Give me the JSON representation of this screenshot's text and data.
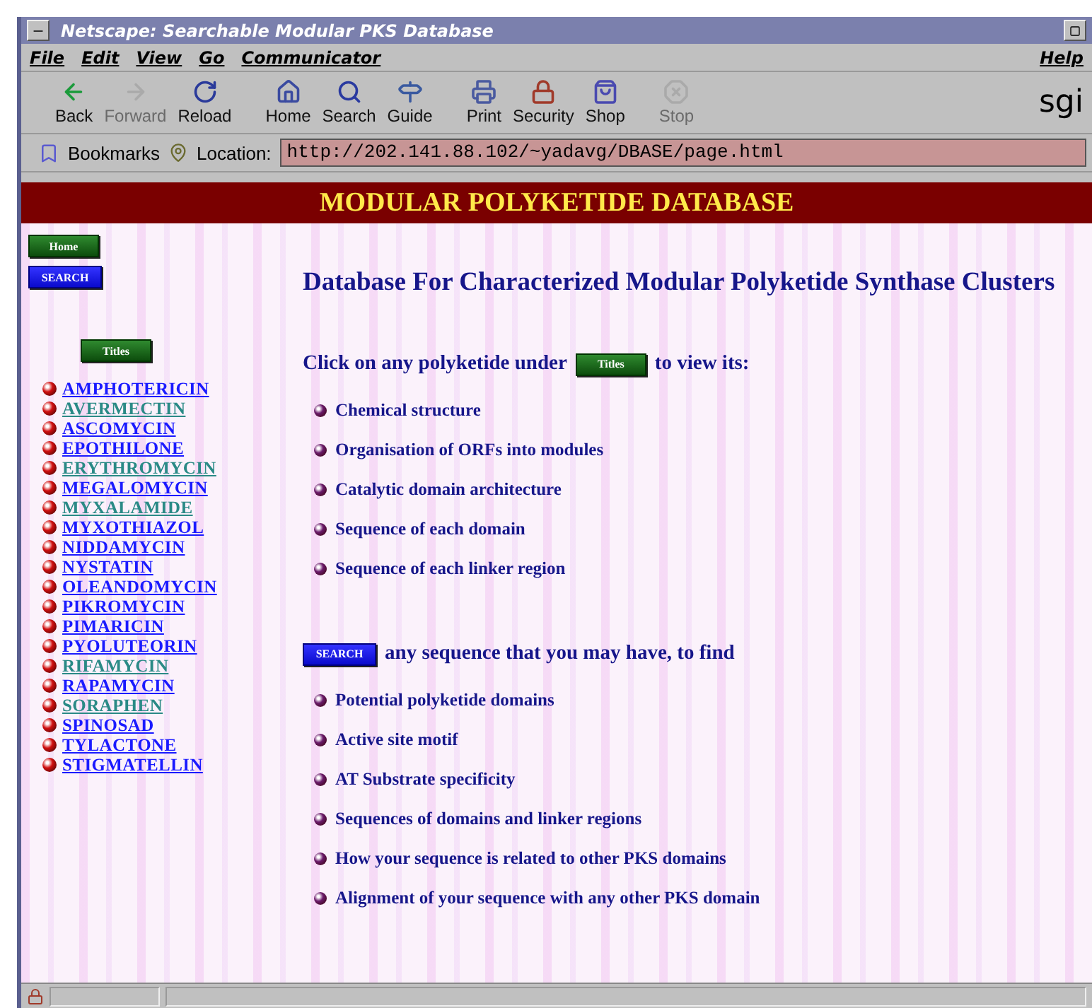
{
  "window": {
    "title": "Netscape: Searchable Modular PKS Database"
  },
  "menu": {
    "items": [
      "File",
      "Edit",
      "View",
      "Go",
      "Communicator"
    ],
    "help": "Help"
  },
  "toolbar": {
    "buttons": [
      {
        "label": "Back",
        "kind": "back",
        "disabled": false
      },
      {
        "label": "Forward",
        "kind": "forward",
        "disabled": true
      },
      {
        "label": "Reload",
        "kind": "reload",
        "disabled": false
      },
      {
        "label": "Home",
        "kind": "home",
        "disabled": false
      },
      {
        "label": "Search",
        "kind": "search",
        "disabled": false
      },
      {
        "label": "Guide",
        "kind": "guide",
        "disabled": false
      },
      {
        "label": "Print",
        "kind": "print",
        "disabled": false
      },
      {
        "label": "Security",
        "kind": "security",
        "disabled": false
      },
      {
        "label": "Shop",
        "kind": "shop",
        "disabled": false
      },
      {
        "label": "Stop",
        "kind": "stop",
        "disabled": true
      }
    ],
    "logo": "sgi"
  },
  "location_bar": {
    "bookmarks": "Bookmarks",
    "label": "Location:",
    "url": "http://202.141.88.102/~yadavg/DBASE/page.html"
  },
  "page": {
    "banner": "MODULAR POLYKETIDE DATABASE",
    "nav_buttons": [
      {
        "label": "Home",
        "kind": "home"
      },
      {
        "label": "SEARCH",
        "kind": "search"
      }
    ],
    "titles_button": "Titles",
    "polyketides": [
      {
        "name": "AMPHOTERICIN",
        "visited": false
      },
      {
        "name": "AVERMECTIN",
        "visited": true
      },
      {
        "name": "ASCOMYCIN",
        "visited": false
      },
      {
        "name": "EPOTHILONE",
        "visited": false
      },
      {
        "name": "ERYTHROMYCIN",
        "visited": true
      },
      {
        "name": "MEGALOMYCIN",
        "visited": false
      },
      {
        "name": "MYXALAMIDE",
        "visited": true
      },
      {
        "name": "MYXOTHIAZOL",
        "visited": false
      },
      {
        "name": "NIDDAMYCIN",
        "visited": false
      },
      {
        "name": "NYSTATIN",
        "visited": false
      },
      {
        "name": "OLEANDOMYCIN",
        "visited": false
      },
      {
        "name": "PIKROMYCIN",
        "visited": false
      },
      {
        "name": "PIMARICIN",
        "visited": false
      },
      {
        "name": "PYOLUTEORIN",
        "visited": false
      },
      {
        "name": "RIFAMYCIN",
        "visited": true
      },
      {
        "name": "RAPAMYCIN",
        "visited": false
      },
      {
        "name": "SORAPHEN",
        "visited": true
      },
      {
        "name": "SPINOSAD",
        "visited": false
      },
      {
        "name": "TYLACTONE",
        "visited": false
      },
      {
        "name": "STIGMATELLIN",
        "visited": false
      }
    ],
    "heading": "Database For Characterized Modular Polyketide Synthase Clusters",
    "view_intro": {
      "before": "Click on any polyketide under",
      "button": "Titles",
      "after": "to view its:"
    },
    "view_features": [
      "Chemical structure",
      "Organisation of ORFs into modules",
      "Catalytic domain architecture",
      "Sequence of each domain",
      "Sequence of each linker region"
    ],
    "search_intro": {
      "button": "SEARCH",
      "after": "any sequence that you may have, to find"
    },
    "search_features": [
      "Potential polyketide domains",
      "Active site motif",
      "AT Substrate specificity",
      "Sequences of domains and linker regions",
      "How your sequence is related to other PKS domains",
      "Alignment of your sequence with any other PKS domain"
    ]
  }
}
